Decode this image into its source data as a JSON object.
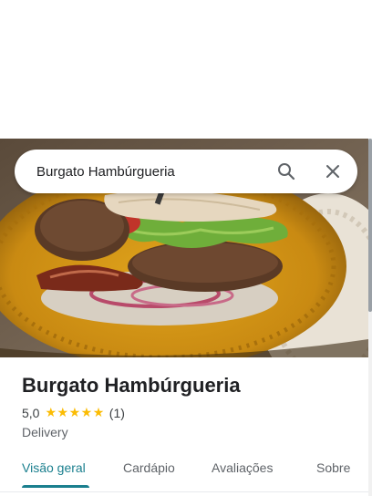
{
  "search": {
    "value": "Burgato Hambúrgueria",
    "search_icon": "search-icon",
    "close_icon": "close-icon"
  },
  "place": {
    "name": "Burgato Hambúrgueria",
    "rating": "5,0",
    "stars": 5,
    "reviews": "(1)",
    "category": "Delivery"
  },
  "tabs": [
    {
      "label": "Visão geral",
      "active": true
    },
    {
      "label": "Cardápio",
      "active": false
    },
    {
      "label": "Avaliações",
      "active": false
    },
    {
      "label": "Sobre",
      "active": false
    }
  ],
  "colors": {
    "accent": "#1a7f8e",
    "star": "#fbbc04"
  }
}
